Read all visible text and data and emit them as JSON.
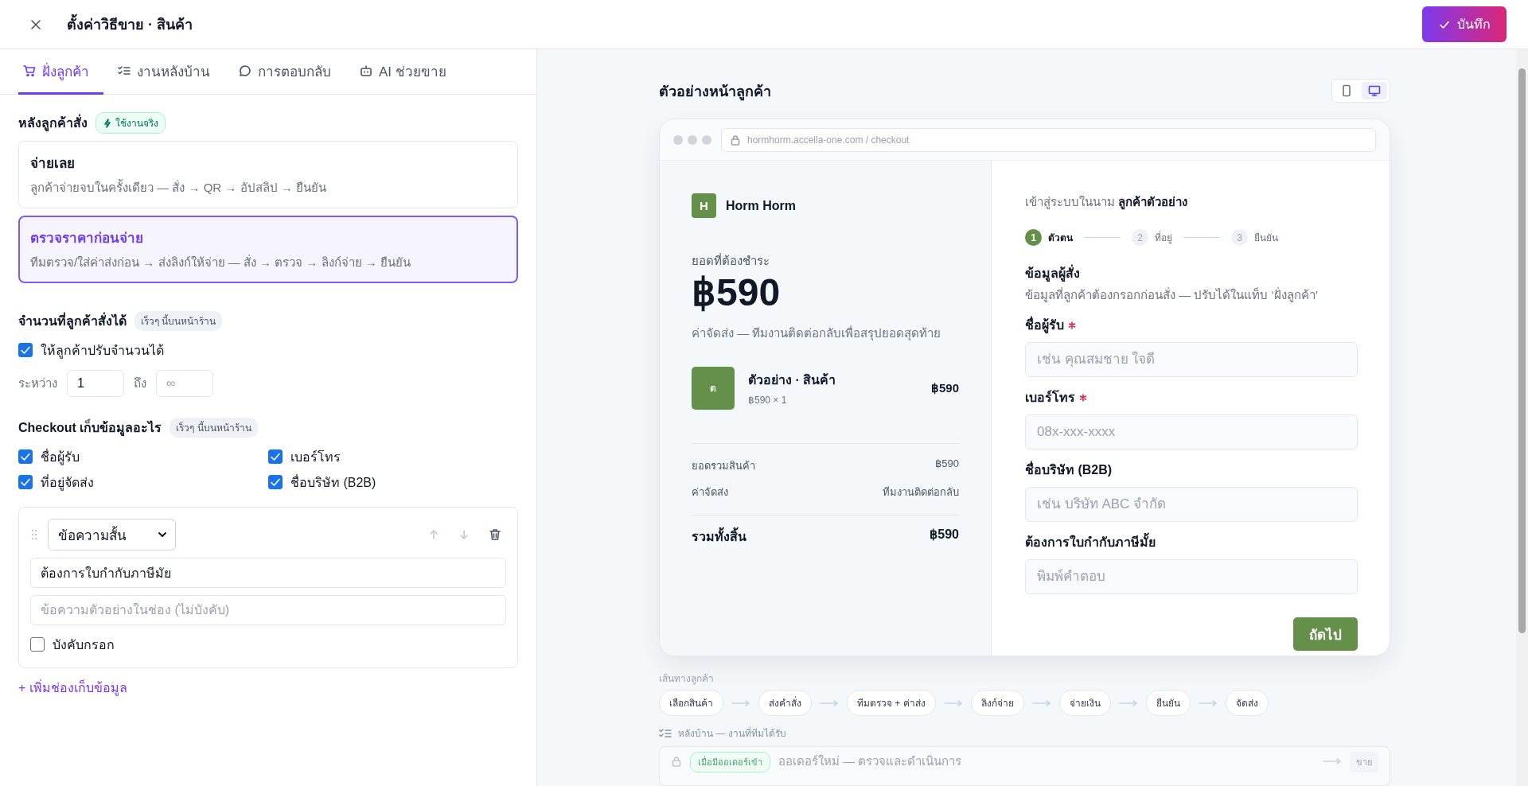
{
  "header": {
    "title": "ตั้งค่าวิธีขาย · สินค้า",
    "save_button": "บันทึก"
  },
  "tabs": [
    {
      "label": "ฝั่งลูกค้า",
      "selected": true
    },
    {
      "label": "งานหลังบ้าน",
      "selected": false
    },
    {
      "label": "การตอบกลับ",
      "selected": false
    },
    {
      "label": "AI ช่วยขาย",
      "selected": false
    }
  ],
  "after_order": {
    "heading": "หลังลูกค้าสั่ง",
    "badge": "ใช้งานจริง",
    "options": [
      {
        "title": "จ่ายเลย",
        "description": "ลูกค้าจ่ายจบในครั้งเดียว — สั่ง → QR → อัปสลิป → ยืนยัน",
        "selected": false
      },
      {
        "title": "ตรวจราคาก่อนจ่าย",
        "description": "ทีมตรวจ/ใส่ค่าส่งก่อน → ส่งลิงก์ให้จ่าย — สั่ง → ตรวจ → ลิงก์จ่าย → ยืนยัน",
        "selected": true
      }
    ]
  },
  "quantity": {
    "heading": "จำนวนที่ลูกค้าสั่งได้",
    "badge": "เร็วๆ นี้บนหน้าร้าน",
    "adjustable": {
      "label": "ให้ลูกค้าปรับจำนวนได้",
      "checked": true
    },
    "range": {
      "from_label": "ระหว่าง",
      "min": "1",
      "to_label": "ถึง",
      "max_placeholder": "∞"
    }
  },
  "checkout_fields": {
    "heading": "Checkout เก็บข้อมูลอะไร",
    "badge": "เร็วๆ นี้บนหน้าร้าน",
    "options": [
      {
        "label": "ชื่อผู้รับ",
        "checked": true
      },
      {
        "label": "เบอร์โทร",
        "checked": true
      },
      {
        "label": "ที่อยู่จัดส่ง",
        "checked": true
      },
      {
        "label": "ชื่อบริษัท (B2B)",
        "checked": true
      }
    ],
    "custom_fields": [
      {
        "type": "ข้อความสั้น",
        "label": "ต้องการใบกำกับภาษีมัย",
        "placeholder": "ข้อความตัวอย่างในช่อง (ไม่บังคับ)",
        "required": {
          "label": "บังคับกรอก",
          "checked": false
        }
      }
    ],
    "add_link": "+ เพิ่มช่องเก็บข้อมูล"
  },
  "preview": {
    "title": "ตัวอย่างหน้าลูกค้า",
    "devices": [
      {
        "selected": false
      },
      {
        "selected": true
      }
    ],
    "url": "hormhorm.accella-one.com / checkout",
    "store": {
      "logo": "H",
      "name": "Horm Horm"
    },
    "amount_label": "ยอดที่ต้องชำระ",
    "amount": "฿590",
    "shipping_note": "ค่าจัดส่ง — ทีมงานติดต่อกลับเพื่อสรุปยอดสุดท้าย",
    "item": {
      "thumb": "ต",
      "name": "ตัวอย่าง · สินค้า",
      "detail": "฿590 × 1",
      "price": "฿590"
    },
    "summary": [
      {
        "label": "ยอดรวมสินค้า",
        "value": "฿590"
      },
      {
        "label": "ค่าจัดส่ง",
        "value": "ทีมงานติดต่อกลับ"
      }
    ],
    "total": {
      "label": "รวมทั้งสิ้น",
      "value": "฿590"
    },
    "signed_in": "เข้าสู่ระบบในนาม **ลูกค้าตัวอย่าง**",
    "steps": [
      {
        "number": "1",
        "label": "ตัวตน",
        "selected": true
      },
      {
        "number": "2",
        "label": "ที่อยู่",
        "selected": false
      },
      {
        "number": "3",
        "label": "ยืนยัน",
        "selected": false
      }
    ],
    "form_title": "ข้อมูลผู้สั่ง",
    "form_subtitle": "ข้อมูลที่ลูกค้าต้องกรอกก่อนสั่ง — ปรับได้ในแท็บ ‘ฝั่งลูกค้า’",
    "fields": [
      {
        "label": "ชื่อผู้รับ",
        "required": true,
        "placeholder": "เช่น คุณสมชาย ใจดี"
      },
      {
        "label": "เบอร์โทร",
        "required": true,
        "placeholder": "08x-xxx-xxxx"
      },
      {
        "label": "ชื่อบริษัท (B2B)",
        "required": false,
        "placeholder": "เช่น บริษัท ABC จำกัด"
      },
      {
        "label": "ต้องการใบกำกับภาษีมั้ย",
        "required": false,
        "placeholder": "พิมพ์คำตอบ"
      }
    ],
    "next_button": "ถัดไป"
  },
  "journey": {
    "label": "เส้นทางลูกค้า",
    "steps": [
      "เลือกสินค้า",
      "ส่งคำสั่ง",
      "ทีมตรวจ + ค่าส่ง",
      "ลิงก์จ่าย",
      "จ่ายเงิน",
      "ยืนยัน",
      "จัดส่ง"
    ]
  },
  "backend": {
    "label": "หลังบ้าน — งานที่ทีมได้รับ",
    "tasks": [
      {
        "trigger": "เมื่อมีออเดอร์เข้า",
        "text": "ออเดอร์ใหม่ — ตรวจและดำเนินการ",
        "tag": "ขาย"
      }
    ]
  }
}
